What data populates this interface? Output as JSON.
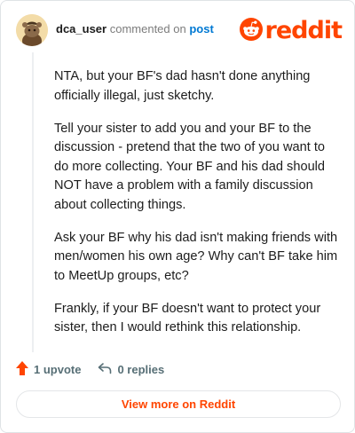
{
  "header": {
    "username": "dca_user",
    "action_text": "commented on",
    "post_link": "post",
    "brand_name": "reddit",
    "avatar_icon": "snoo-avatar-icon",
    "brand_icon": "reddit-logo-icon"
  },
  "comment": {
    "paragraphs": [
      "NTA, but your BF's dad hasn't done anything officially illegal, just sketchy.",
      "Tell your sister to add you and your BF to the discussion - pretend that the two of you want to do more collecting. Your BF and his dad should NOT have a problem with a family discussion about collecting things.",
      "Ask your BF why his dad isn't making friends with men/women his own age? Why can't BF take him to MeetUp groups, etc?",
      "Frankly, if your BF doesn't want to protect your sister, then I would rethink this relationship."
    ]
  },
  "actions": {
    "upvote_label": "1 upvote",
    "replies_label": "0 replies",
    "upvote_icon": "upvote-arrow-icon",
    "reply_icon": "reply-arrow-icon"
  },
  "footer": {
    "view_more_label": "View more on Reddit"
  },
  "colors": {
    "brand": "#ff4500",
    "link": "#0079d3",
    "muted": "#576f76"
  }
}
